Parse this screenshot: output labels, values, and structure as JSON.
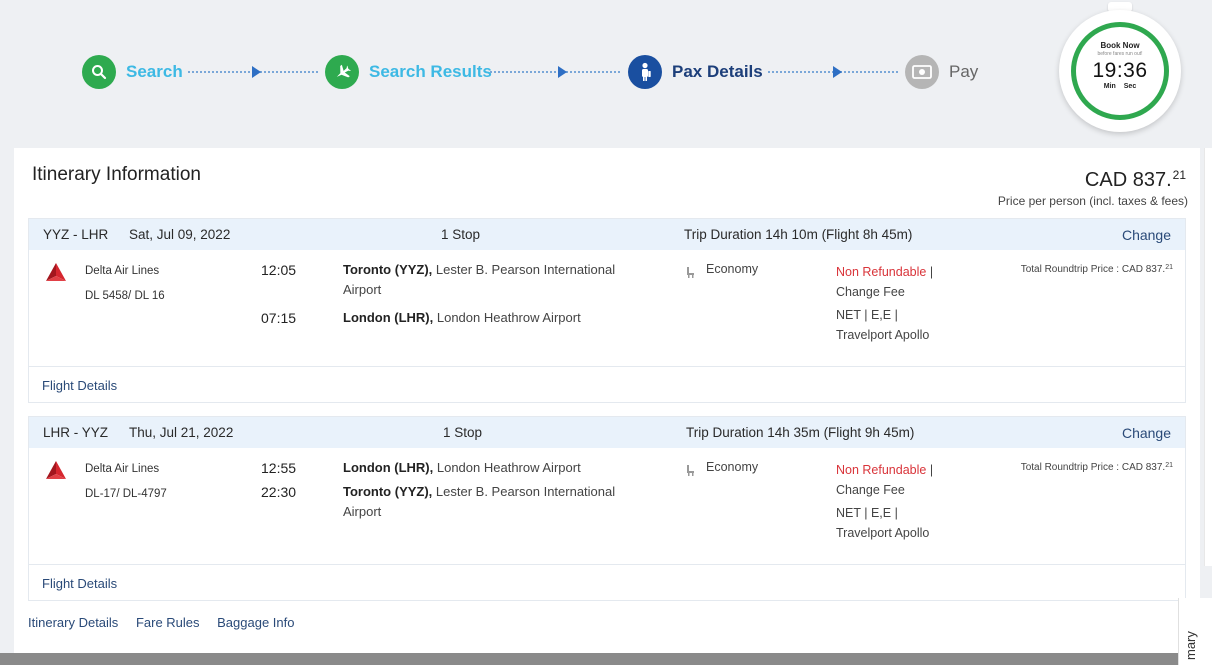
{
  "steps": [
    {
      "label": "Search",
      "icon": "search-icon",
      "state": "done"
    },
    {
      "label": "Search Results",
      "icon": "plane-icon",
      "state": "done"
    },
    {
      "label": "Pax Details",
      "icon": "passenger-icon",
      "state": "current"
    },
    {
      "label": "Pay",
      "icon": "money-icon",
      "state": "pending"
    }
  ],
  "timer": {
    "title": "Book Now",
    "subtitle": "before fares run out!",
    "time": "19:36",
    "units": "Min Sec"
  },
  "itinerary": {
    "title": "Itinerary Information",
    "price_main": "CAD 837.",
    "price_cents": "21",
    "price_note": "Price per person (incl. taxes & fees)"
  },
  "segments": [
    {
      "route": "YYZ - LHR",
      "date": "Sat, Jul 09, 2022",
      "stops": "1 Stop",
      "duration": "Trip Duration 14h 10m (Flight 8h 45m)",
      "change": "Change",
      "airline": "Delta Air Lines",
      "flight_no": "DL 5458/ DL 16",
      "dep_time": "12:05",
      "dep_place_bold": "Toronto (YYZ),",
      "dep_place": " Lester B. Pearson International Airport",
      "arr_time": "07:15",
      "arr_place_bold": "London (LHR),",
      "arr_place": " London Heathrow Airport",
      "cabin": "Economy",
      "refund": "Non Refundable",
      "refund_sep": " |",
      "change_fee": "Change Fee",
      "fare_code": "NET | E,E |",
      "gds": "Travelport Apollo",
      "total": "Total Roundtrip Price : CAD 837.",
      "total_cents": "21",
      "details": "Flight Details"
    },
    {
      "route": "LHR - YYZ",
      "date": "Thu, Jul 21, 2022",
      "stops": "1 Stop",
      "duration": "Trip Duration 14h 35m (Flight 9h 45m)",
      "change": "Change",
      "airline": "Delta Air Lines",
      "flight_no": "DL-17/ DL-4797",
      "dep_time": "12:55",
      "dep_place_bold": "London (LHR),",
      "dep_place": " London Heathrow Airport",
      "arr_time": "22:30",
      "arr_place_bold": "Toronto (YYZ),",
      "arr_place": " Lester B. Pearson International Airport",
      "cabin": "Economy",
      "refund": "Non Refundable",
      "refund_sep": " |",
      "change_fee": "Change Fee",
      "fare_code": "NET | E,E |",
      "gds": "Travelport Apollo",
      "total": "Total Roundtrip Price : CAD 837.",
      "total_cents": "21",
      "details": "Flight Details"
    }
  ],
  "links": [
    "Itinerary Details",
    "Fare Rules",
    "Baggage Info"
  ],
  "summary_tab": "mary",
  "colors": {
    "done": "#2eaa4f",
    "current": "#1a4fa0",
    "pending": "#b5b5b5",
    "link": "#3db9e4",
    "alert": "#d9343a",
    "delta": "#d6262f"
  }
}
